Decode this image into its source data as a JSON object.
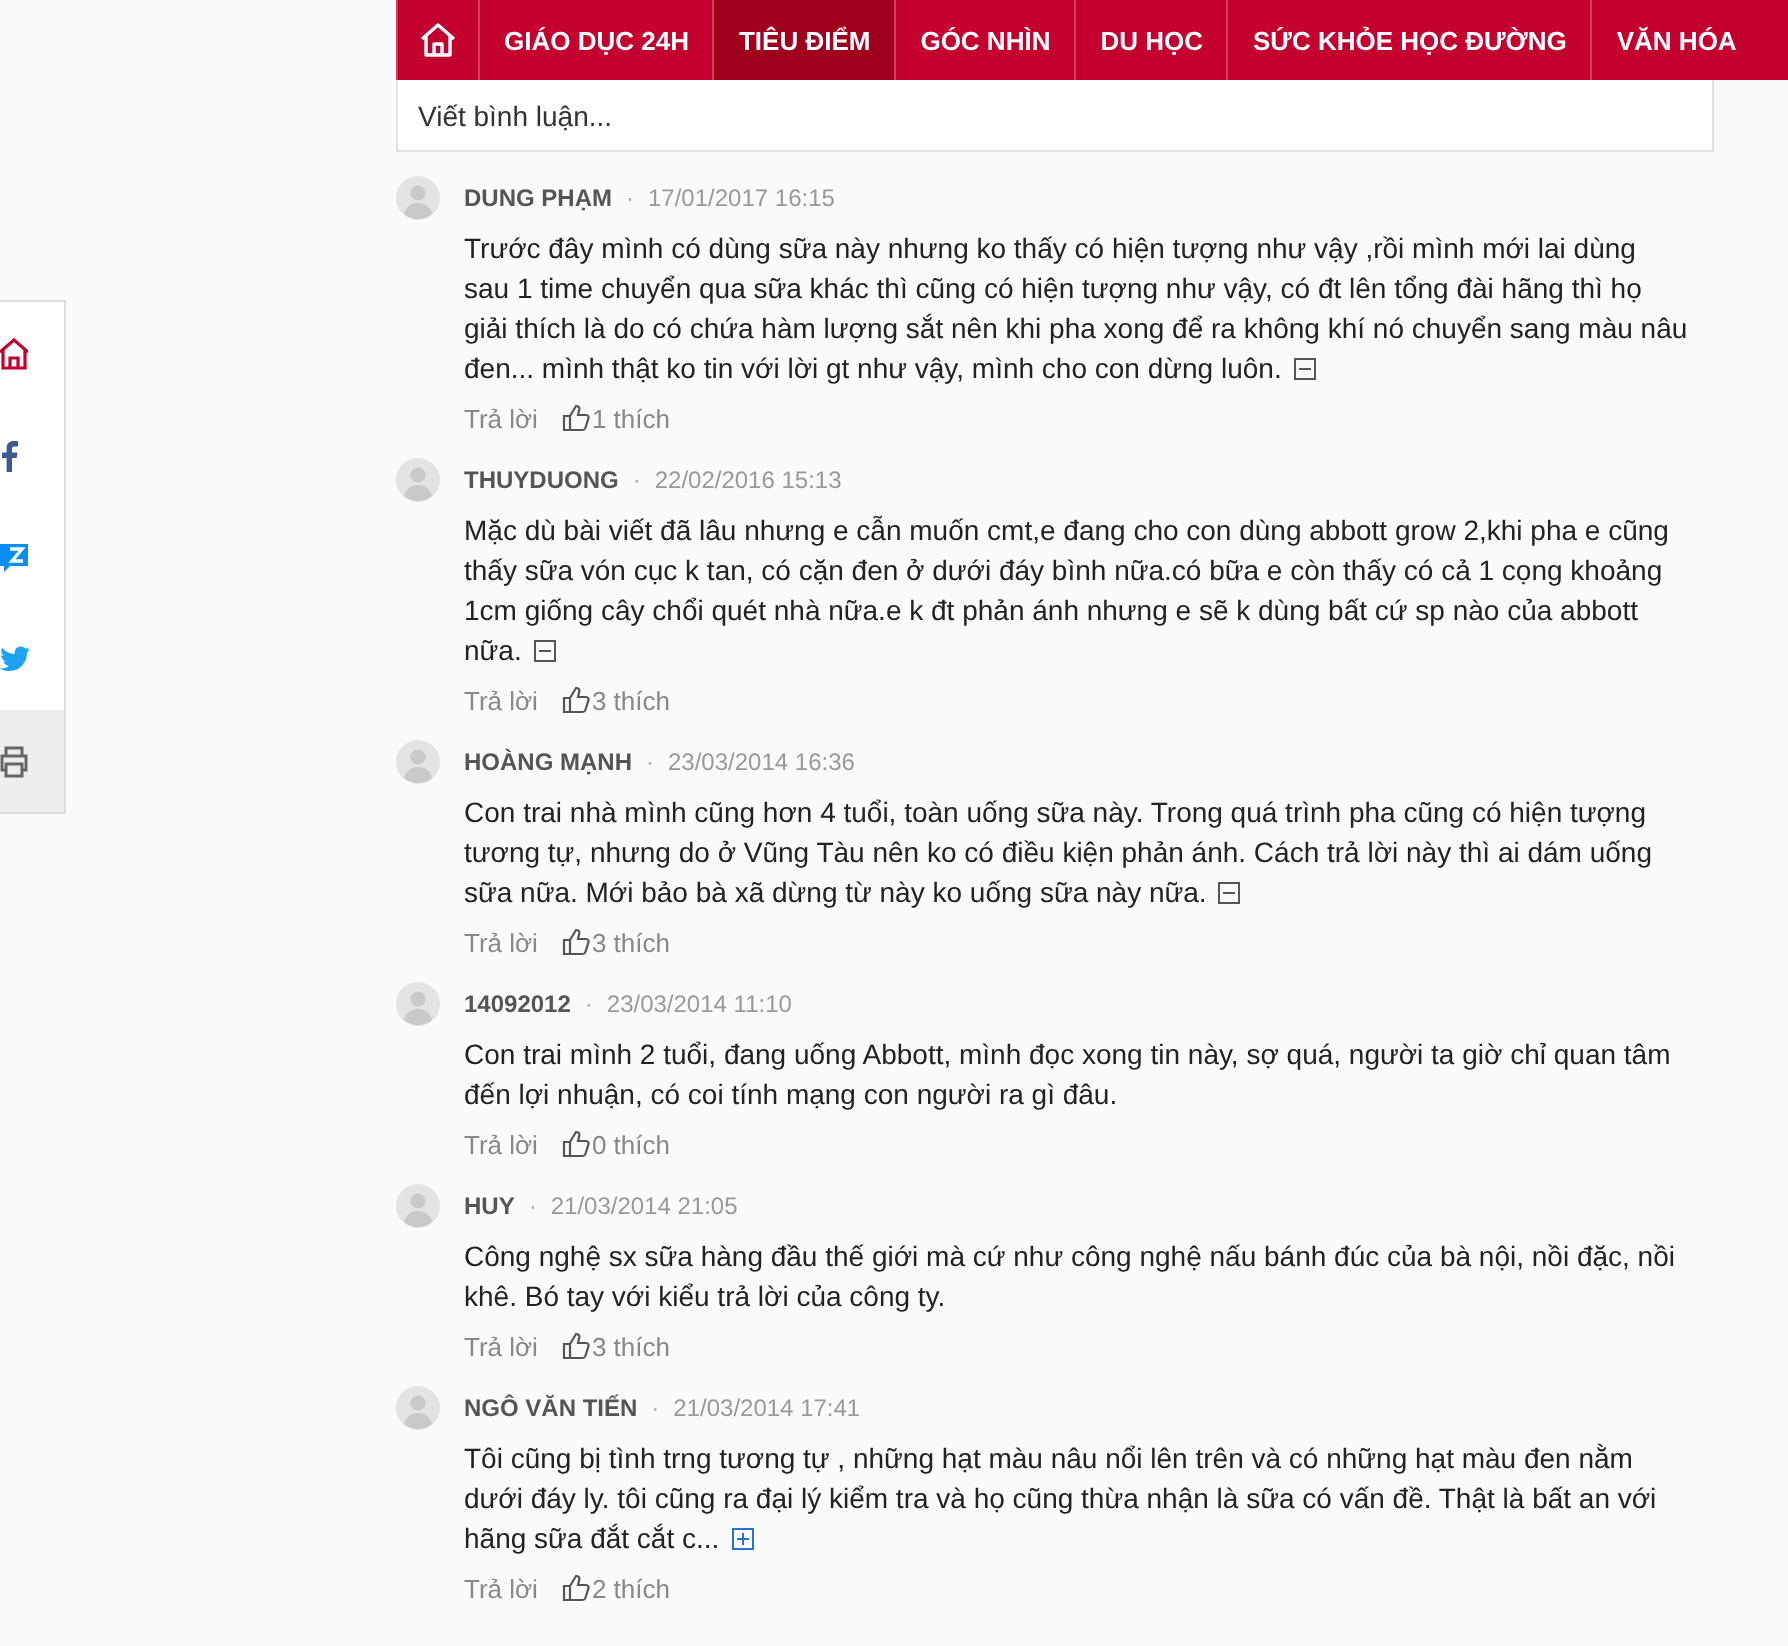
{
  "nav": {
    "items": [
      {
        "kind": "home",
        "selected": false
      },
      {
        "kind": "text",
        "label": "GIÁO DỤC 24H",
        "selected": false
      },
      {
        "kind": "text",
        "label": "TIÊU ĐIỂM",
        "selected": true
      },
      {
        "kind": "text",
        "label": "GÓC NHÌN",
        "selected": false
      },
      {
        "kind": "text",
        "label": "DU HỌC",
        "selected": false
      },
      {
        "kind": "text",
        "label": "SỨC KHỎE HỌC ĐƯỜNG",
        "selected": false
      },
      {
        "kind": "text",
        "label": "VĂN HÓA",
        "selected": false
      }
    ]
  },
  "share_bar": {
    "items": [
      {
        "kind": "home"
      },
      {
        "kind": "facebook"
      },
      {
        "kind": "zalo"
      },
      {
        "kind": "twitter"
      },
      {
        "kind": "print"
      }
    ]
  },
  "comment_box": {
    "placeholder": "Viết bình luận..."
  },
  "comments": [
    {
      "author": "DUNG PHẠM",
      "separator": "·",
      "time": "17/01/2017 16:15",
      "text": "Trước đây mình có dùng sữa này nhưng ko thấy có hiện tượng như vậy ,rồi mình mới lai dùng sau 1 time chuyển qua sữa khác thì cũng có hiện tượng như vậy, có đt lên tổng đài hãng thì họ giải thích là do có chứa hàm lượng sắt nên khi pha xong để ra không khí nó chuyển sang màu nâu đen... mình thật ko tin với lời gt như vậy, mình cho con dừng luôn.",
      "expanded": true,
      "reply": "Trả lời",
      "likes": "1 thích"
    },
    {
      "author": "THUYDUONG",
      "separator": "·",
      "time": "22/02/2016 15:13",
      "text": "Mặc dù bài viết đã lâu nhưng e cẫn muốn cmt,e đang cho con dùng abbott grow 2,khi pha e cũng thấy sữa vón cục k tan, có cặn đen ở dưới đáy bình nữa.có bữa e còn thấy có cả 1 cọng khoảng 1cm giống cây chổi quét nhà nữa.e k đt phản ánh nhưng e sẽ k dùng bất cứ sp nào của abbott nữa.",
      "expanded": true,
      "reply": "Trả lời",
      "likes": "3 thích"
    },
    {
      "author": "HOÀNG MẠNH",
      "separator": "·",
      "time": "23/03/2014 16:36",
      "text": "Con trai nhà mình cũng hơn 4 tuổi, toàn uống sữa này. Trong quá trình pha cũng có hiện tượng tương tự, nhưng do ở Vũng Tàu nên ko có điều kiện phản ánh. Cách trả lời này thì ai dám uống sữa nữa. Mới bảo bà xã dừng từ này ko uống sữa này nữa.",
      "expanded": true,
      "reply": "Trả lời",
      "likes": "3 thích"
    },
    {
      "author": "14092012",
      "separator": "·",
      "time": "23/03/2014 11:10",
      "text": "Con trai mình 2 tuổi, đang uống Abbott, mình đọc xong tin này, sợ quá, người ta giờ chỉ quan tâm đến lợi nhuận, có coi tính mạng con người ra gì đâu.",
      "reply": "Trả lời",
      "likes": "0 thích"
    },
    {
      "author": "HUY",
      "separator": "·",
      "time": "21/03/2014 21:05",
      "text": "Công nghệ sx sữa hàng đầu thế giới mà cứ như công nghệ nấu bánh đúc của bà nội, nồi đặc, nồi khê. Bó tay với kiểu trả lời của công ty.",
      "reply": "Trả lời",
      "likes": "3 thích"
    },
    {
      "author": "NGÔ VĂN TIẾN",
      "separator": "·",
      "time": "21/03/2014 17:41",
      "text": "Tôi cũng bị tình trng tương tự , những hạt màu nâu nổi lên trên và có những hạt màu đen nằm dưới đáy ly. tôi cũng ra đại lý kiểm tra và họ cũng thừa nhận là sữa có vấn đề. Thật là bất an với hãng sữa đắt cắt c...",
      "expanded": false,
      "reply": "Trả lời",
      "likes": "2 thích"
    }
  ]
}
